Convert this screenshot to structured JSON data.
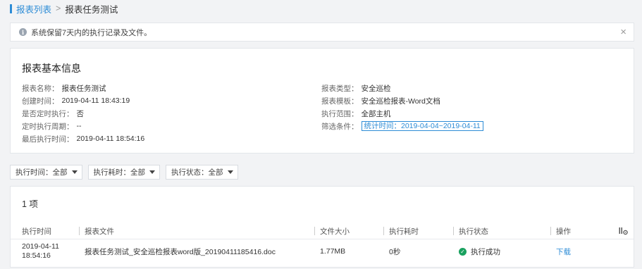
{
  "breadcrumb": {
    "parent": "报表列表",
    "separator": ">",
    "current": "报表任务测试"
  },
  "notice": {
    "text": "系统保留7天内的执行记录及文件。"
  },
  "info": {
    "title": "报表基本信息",
    "left": [
      {
        "label": "报表名称：",
        "value": "报表任务测试"
      },
      {
        "label": "创建时间：",
        "value": "2019-04-11 18:43:19"
      },
      {
        "label": "是否定时执行：",
        "value": "否"
      },
      {
        "label": "定时执行周期：",
        "value": "--"
      },
      {
        "label": "最后执行时间：",
        "value": "2019-04-11 18:54:16"
      }
    ],
    "right": [
      {
        "label": "报表类型：",
        "value": "安全巡检"
      },
      {
        "label": "报表模板：",
        "value": "安全巡检报表-Word文档"
      },
      {
        "label": "执行范围：",
        "value": "全部主机"
      },
      {
        "label": "筛选条件：",
        "value": "统计时间：2019-04-04~2019-04-11"
      }
    ]
  },
  "filters": [
    {
      "label": "执行时间：全部"
    },
    {
      "label": "执行耗时：全部"
    },
    {
      "label": "执行状态：全部"
    }
  ],
  "table": {
    "count_label": "1 项",
    "columns": [
      "执行时间",
      "报表文件",
      "文件大小",
      "执行耗时",
      "执行状态",
      "操作"
    ],
    "rows": [
      {
        "time_date": "2019-04-11",
        "time_clock": "18:54:16",
        "file": "报表任务测试_安全巡检报表word版_20190411185416.doc",
        "size": "1.77MB",
        "duration": "0秒",
        "status": "执行成功",
        "action": "下载"
      }
    ]
  },
  "colors": {
    "accent": "#2d8cd6",
    "success": "#19a15f"
  },
  "icons": [
    "info-icon",
    "close-icon",
    "chevron-down-icon",
    "check-circle-icon",
    "column-settings-icon"
  ]
}
